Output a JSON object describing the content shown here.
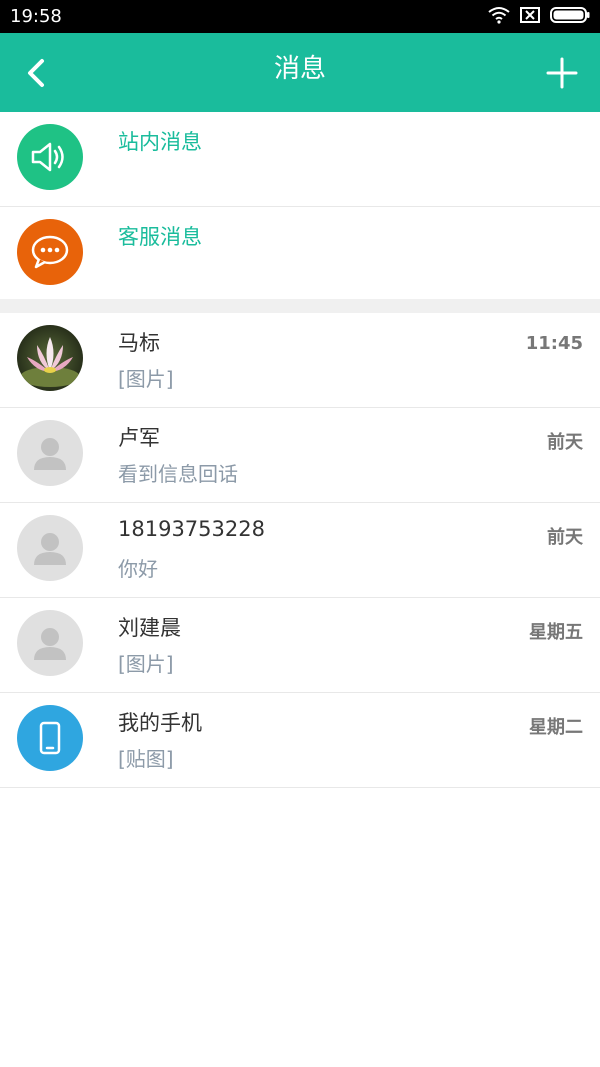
{
  "status_bar": {
    "time": "19:58"
  },
  "header": {
    "title": "消息"
  },
  "system_items": [
    {
      "name": "站内消息",
      "icon": "speaker-icon",
      "color": "#1abc9c"
    },
    {
      "name": "客服消息",
      "icon": "chat-bubble-icon",
      "color": "#e8630a"
    }
  ],
  "conversations": [
    {
      "name": "马标",
      "preview": "[图片]",
      "time": "11:45",
      "avatar": "lotus-photo"
    },
    {
      "name": "卢军",
      "preview": "看到信息回话",
      "time": "前天",
      "avatar": "default-user-icon"
    },
    {
      "name": "18193753228",
      "preview": "你好",
      "time": "前天",
      "avatar": "default-user-icon"
    },
    {
      "name": "刘建晨",
      "preview": "[图片]",
      "time": "星期五",
      "avatar": "default-user-icon"
    },
    {
      "name": "我的手机",
      "preview": "[贴图]",
      "time": "星期二",
      "avatar": "phone-icon"
    }
  ],
  "colors": {
    "accent": "#1abc9c",
    "service": "#e8630a",
    "phone": "#2fa6e0",
    "default_avatar": "#e0e0e0"
  }
}
